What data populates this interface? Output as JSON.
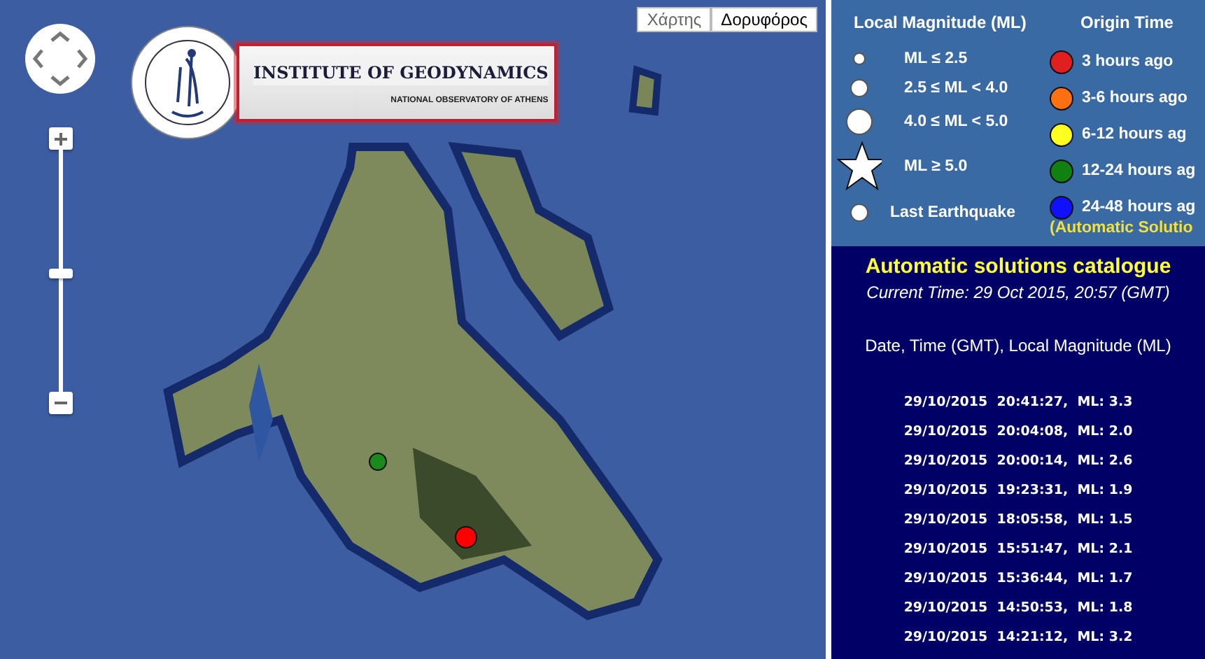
{
  "map": {
    "map_types": [
      {
        "label": "Χάρτης",
        "selected": false
      },
      {
        "label": "Δορυφόρος",
        "selected": true
      }
    ],
    "zoom": {
      "level": 0.5
    },
    "logo": {
      "title": "INSTITUTE OF GEODYNAMICS",
      "subtitle": "NATIONAL OBSERVATORY OF ATHENS"
    },
    "markers": [
      {
        "color": "#1a8a1a",
        "kind": "small"
      },
      {
        "color": "#ff0000",
        "kind": "large"
      }
    ]
  },
  "legend": {
    "magnitude_title": "Local Magnitude (ML)",
    "origin_title": "Origin Time",
    "magnitudes": [
      {
        "kind": "dot-small",
        "label": "ML ≤ 2.5"
      },
      {
        "kind": "dot-medium",
        "label": "2.5 ≤ ML < 4.0"
      },
      {
        "kind": "dot-large",
        "label": "4.0 ≤ ML < 5.0"
      },
      {
        "kind": "star",
        "label": "ML ≥ 5.0"
      },
      {
        "kind": "dot-medium",
        "label": "Last Earthquake"
      }
    ],
    "origin_times": [
      {
        "color": "#e02020",
        "label": "3 hours ago"
      },
      {
        "color": "#ff7010",
        "label": "3-6 hours ago"
      },
      {
        "color": "#ffff20",
        "label": "6-12 hours ag"
      },
      {
        "color": "#108010",
        "label": "12-24 hours ag"
      },
      {
        "color": "#1010ff",
        "label": "24-48 hours ag"
      }
    ],
    "note": "(Automatic Solutio"
  },
  "catalogue": {
    "title": "Automatic solutions catalogue",
    "current_time": "Current Time: 29 Oct 2015, 20:57 (GMT)",
    "columns": "Date, Time (GMT), Local Magnitude (ML)",
    "rows": [
      "29/10/2015  20:41:27,  ML: 3.3",
      "29/10/2015  20:04:08,  ML: 2.0",
      "29/10/2015  20:00:14,  ML: 2.6",
      "29/10/2015  19:23:31,  ML: 1.9",
      "29/10/2015  18:05:58,  ML: 1.5",
      "29/10/2015  15:51:47,  ML: 2.1",
      "29/10/2015  15:36:44,  ML: 1.7",
      "29/10/2015  14:50:53,  ML: 1.8",
      "29/10/2015  14:21:12,  ML: 3.2"
    ]
  }
}
